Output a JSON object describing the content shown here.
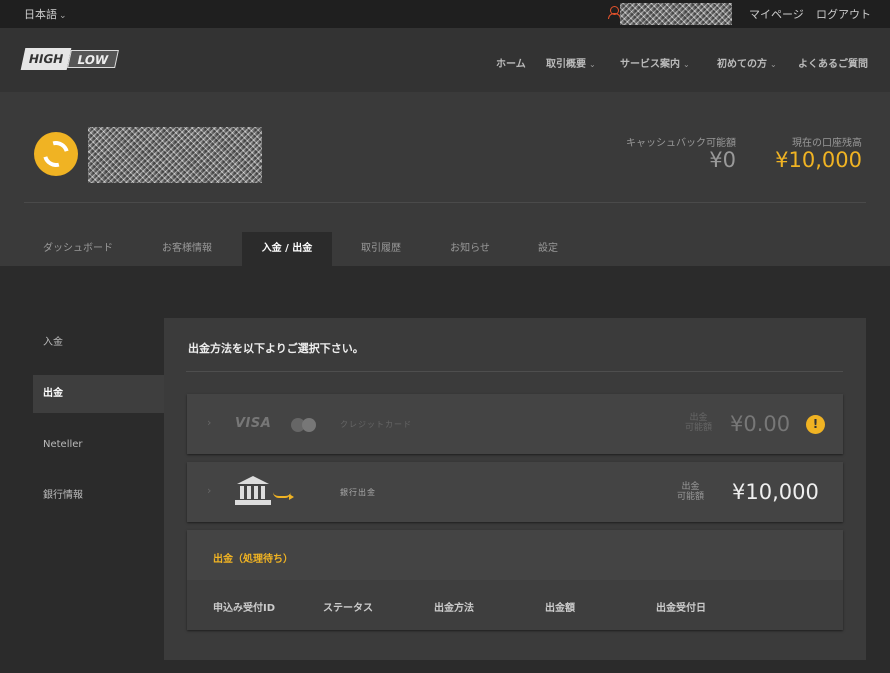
{
  "topbar": {
    "language": "日本語",
    "links": [
      "マイページ",
      "ログアウト"
    ]
  },
  "nav": {
    "logo": {
      "part1": "HIGH",
      "part2": "LOW"
    },
    "items": [
      {
        "label": "ホーム",
        "dropdown": false
      },
      {
        "label": "取引概要",
        "dropdown": true
      },
      {
        "label": "サービス案内",
        "dropdown": true
      },
      {
        "label": "初めての方",
        "dropdown": true
      },
      {
        "label": "よくあるご質問",
        "dropdown": false
      }
    ]
  },
  "account": {
    "cashback_label": "キャッシュバック可能額",
    "cashback_value": "¥0",
    "balance_label": "現在の口座残高",
    "balance_value": "¥10,000",
    "tabs": [
      "ダッシュボード",
      "お客様情報",
      "入金 / 出金",
      "取引履歴",
      "お知らせ",
      "設定"
    ]
  },
  "sidebar": {
    "items": [
      "入金",
      "出金",
      "Neteller",
      "銀行情報"
    ]
  },
  "withdraw": {
    "title": "出金方法を以下よりご選択下さい。",
    "methods": [
      {
        "brand": "VISA",
        "label": "クレジットカード",
        "avail_line1": "出金",
        "avail_line2": "可能額",
        "amount": "¥0.00",
        "warning": "!"
      },
      {
        "label": "銀行出金",
        "avail_line1": "出金",
        "avail_line2": "可能額",
        "amount": "¥10,000"
      }
    ],
    "pending": {
      "title": "出金（処理待ち）",
      "columns": [
        "申込み受付ID",
        "ステータス",
        "出金方法",
        "出金額",
        "出金受付日"
      ]
    }
  },
  "colors": {
    "accent": "#f0b323",
    "user_icon": "#e2522b"
  }
}
